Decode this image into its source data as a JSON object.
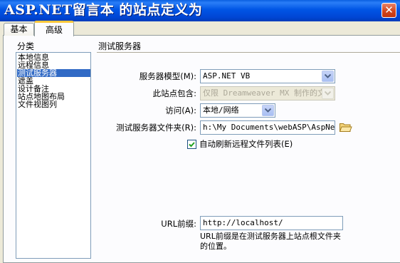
{
  "window": {
    "title": "ASP.NET留言本 的站点定义为",
    "close_glyph": "✕"
  },
  "tabs": [
    {
      "label": "基本"
    },
    {
      "label": "高级"
    }
  ],
  "category": {
    "label": "分类",
    "items": [
      "本地信息",
      "远程信息",
      "测试服务器",
      "遮盖",
      "设计备注",
      "站点地图布局",
      "文件视图列"
    ],
    "selected_index": 2
  },
  "section": {
    "title": "测试服务器"
  },
  "form": {
    "server_model_label": "服务器模型(M):",
    "server_model_value": "ASP.NET VB",
    "site_contains_label": "此站点包含:",
    "site_contains_value": "仅限 Dreamweaver MX 制作的文",
    "access_label": "访问(A):",
    "access_value": "本地/网络",
    "folder_label": "测试服务器文件夹(R):",
    "folder_value": "h:\\My Documents\\webASP\\AspNet\\",
    "auto_refresh_label": "自动刷新远程文件列表(E)",
    "auto_refresh_checked": true,
    "url_prefix_label": "URL前缀:",
    "url_prefix_value": "http://localhost/",
    "url_help": "URL前缀是在测试服务器上站点根文件夹的位置。"
  },
  "colors": {
    "titlebar": "#0055e5",
    "selection": "#316ac5",
    "tab_highlight": "#ffc83c"
  },
  "icons": {
    "folder": "folder-icon",
    "dropdown": "chevron-down-icon",
    "check": "checkmark-icon"
  }
}
